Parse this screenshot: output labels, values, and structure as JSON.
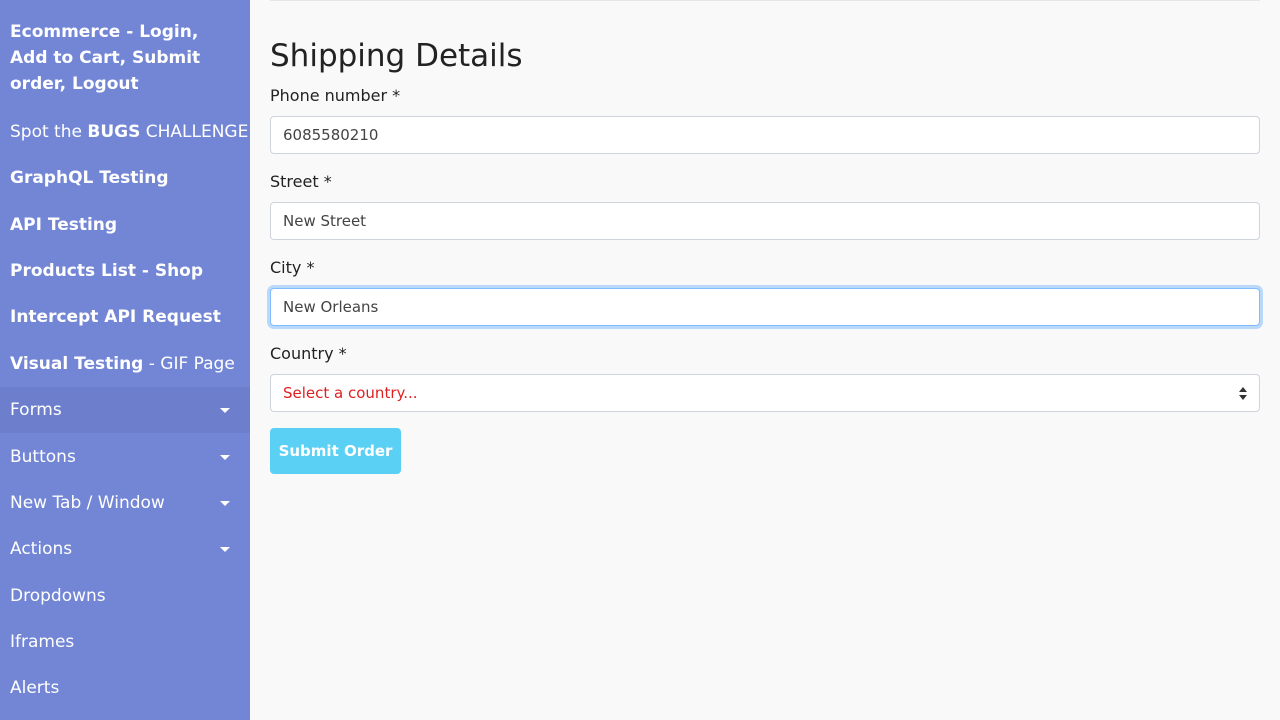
{
  "sidebar": {
    "title": "Ecommerce - Login, Add to Cart, Submit order, Logout",
    "spot_bugs": {
      "pre": "Spot the ",
      "bold": "BUGS",
      "post": " CHALLENGE"
    },
    "graphql": "GraphQL Testing",
    "api_testing": "API Testing",
    "products_list": "Products List - Shop",
    "intercept": "Intercept API Request",
    "visual_testing": {
      "bold": "Visual Testing",
      "post": " - GIF Page"
    },
    "forms": "Forms",
    "buttons": "Buttons",
    "new_tab": "New Tab / Window",
    "actions": "Actions",
    "dropdowns": "Dropdowns",
    "iframes": "Iframes",
    "alerts": "Alerts"
  },
  "main": {
    "title": "Shipping Details",
    "phone": {
      "label": "Phone number *",
      "value": "6085580210"
    },
    "street": {
      "label": "Street *",
      "value": "New Street"
    },
    "city": {
      "label": "City *",
      "value": "New Orleans"
    },
    "country": {
      "label": "Country *",
      "selected": "Select a country..."
    },
    "submit_label": "Submit Order"
  },
  "colors": {
    "sidebar_bg": "#7386d5",
    "sidebar_active": "#6d7fcc",
    "submit_bg": "#5bd0f5",
    "select_placeholder": "#e02020"
  },
  "icons": {
    "dropdown_caret": "caret-down-icon",
    "select_arrows": "select-arrows-icon"
  }
}
